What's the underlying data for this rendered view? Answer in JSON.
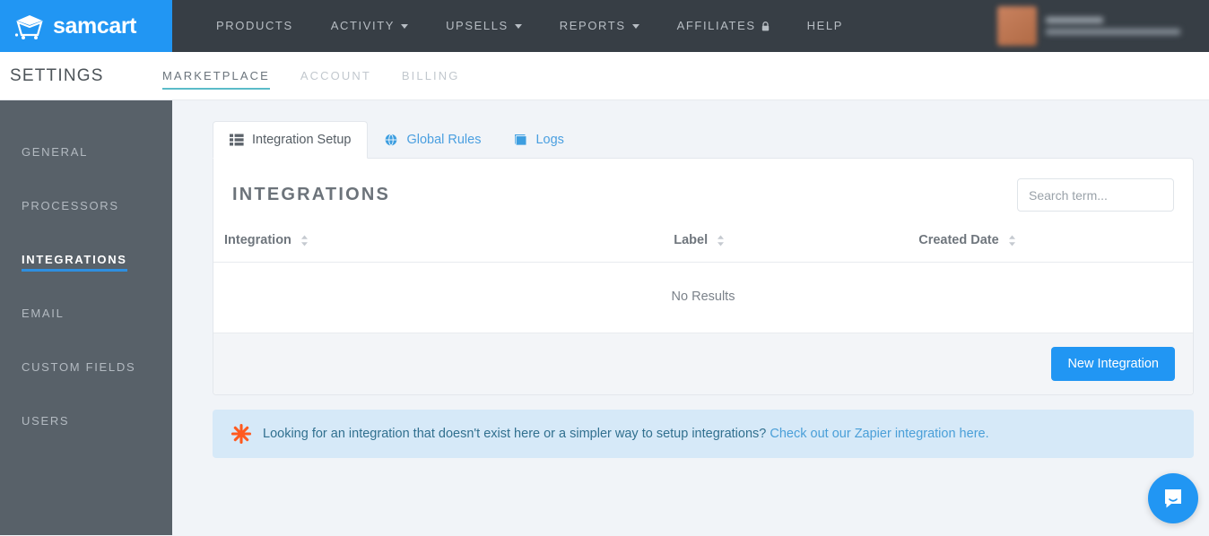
{
  "topbar": {
    "brand_name": "samcart",
    "brand_logo_icon": "shopping-cart-icon",
    "nav": [
      {
        "label": "PRODUCTS",
        "caret": false,
        "lock": false
      },
      {
        "label": "ACTIVITY",
        "caret": true,
        "lock": false
      },
      {
        "label": "UPSELLS",
        "caret": true,
        "lock": false
      },
      {
        "label": "REPORTS",
        "caret": true,
        "lock": false
      },
      {
        "label": "AFFILIATES",
        "caret": false,
        "lock": true
      },
      {
        "label": "HELP",
        "caret": false,
        "lock": false
      }
    ]
  },
  "subheader": {
    "title": "SETTINGS",
    "tabs": [
      {
        "label": "MARKETPLACE",
        "active": true
      },
      {
        "label": "ACCOUNT",
        "active": false
      },
      {
        "label": "BILLING",
        "active": false
      }
    ]
  },
  "sidebar": {
    "items": [
      {
        "label": "GENERAL",
        "active": false
      },
      {
        "label": "PROCESSORS",
        "active": false
      },
      {
        "label": "INTEGRATIONS",
        "active": true
      },
      {
        "label": "EMAIL",
        "active": false
      },
      {
        "label": "CUSTOM FIELDS",
        "active": false
      },
      {
        "label": "USERS",
        "active": false
      }
    ]
  },
  "panel": {
    "tabs": [
      {
        "label": "Integration Setup",
        "icon": "list-icon",
        "active": true
      },
      {
        "label": "Global Rules",
        "icon": "globe-icon",
        "active": false
      },
      {
        "label": "Logs",
        "icon": "book-icon",
        "active": false
      }
    ],
    "title": "INTEGRATIONS",
    "search": {
      "value": "",
      "placeholder": "Search term..."
    },
    "table": {
      "columns": [
        "Integration",
        "Label",
        "Created Date"
      ],
      "rows": [],
      "empty_message": "No Results"
    },
    "new_integration_label": "New Integration"
  },
  "banner": {
    "icon": "zapier-starburst-icon",
    "text": "Looking for an integration that doesn't exist here or a simpler way to setup integrations?",
    "link_text": "Check out our Zapier integration here."
  },
  "chat": {
    "icon": "chat-bubble-icon"
  },
  "colors": {
    "brand_blue": "#2196f3",
    "topbar_dark": "#373e45",
    "sidebar_gray": "#586169",
    "accent_teal": "#5bbcc9",
    "banner_bg": "#d6e9f8",
    "zapier_orange": "#ff4a00"
  }
}
